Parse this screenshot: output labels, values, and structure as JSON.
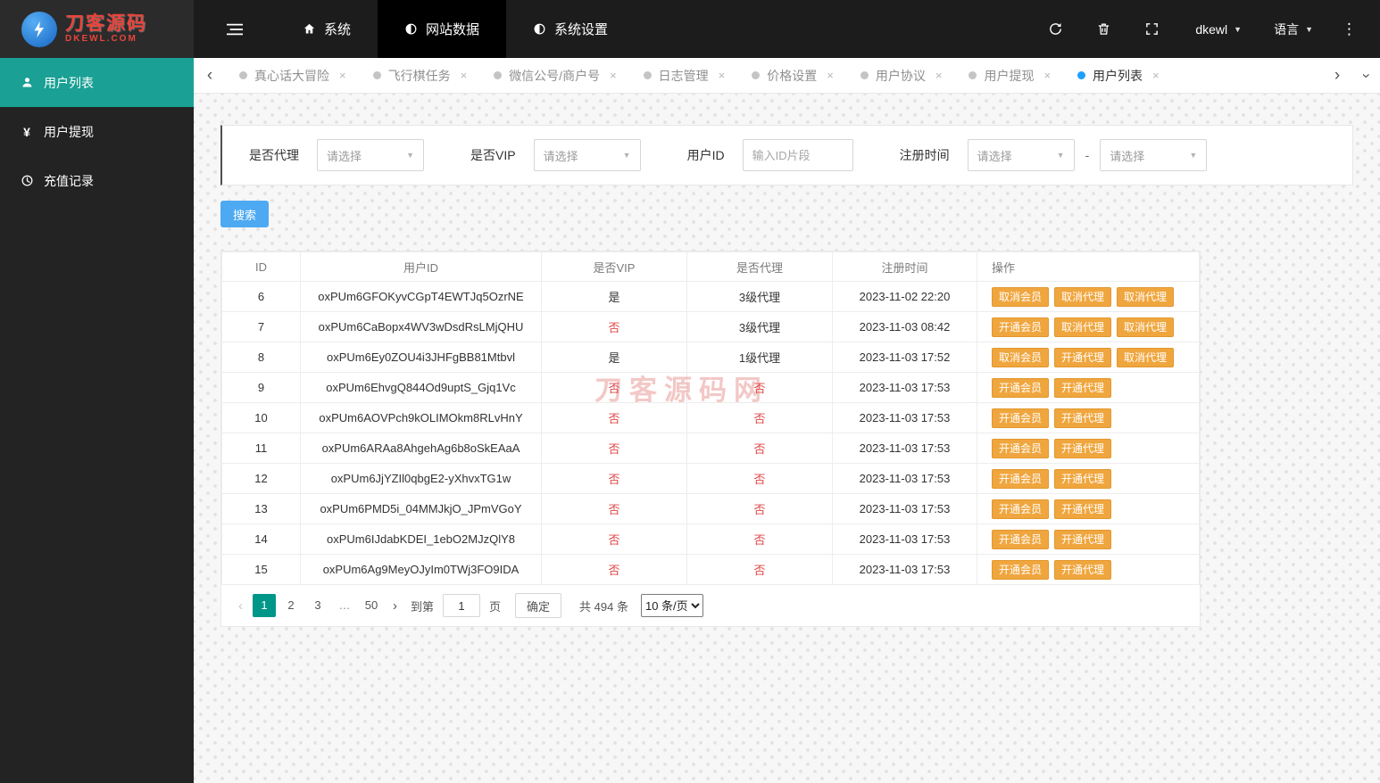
{
  "topbar": {
    "logo_title": "刀客源码",
    "logo_sub": "DKEWL.COM",
    "nav": [
      {
        "label": "系统",
        "icon": "home-icon",
        "active": false
      },
      {
        "label": "网站数据",
        "icon": "chart-pie-icon",
        "active": true
      },
      {
        "label": "系统设置",
        "icon": "settings-circle-icon",
        "active": false
      }
    ],
    "username": "dkewl",
    "language": "语言"
  },
  "sidebar": {
    "items": [
      {
        "label": "用户列表",
        "icon": "user-icon",
        "active": true
      },
      {
        "label": "用户提现",
        "icon": "yen-icon",
        "active": false
      },
      {
        "label": "充值记录",
        "icon": "clock-icon",
        "active": false
      }
    ]
  },
  "tabs": {
    "items": [
      {
        "label": "真心话大冒险",
        "active": false
      },
      {
        "label": "飞行棋任务",
        "active": false
      },
      {
        "label": "微信公号/商户号",
        "active": false
      },
      {
        "label": "日志管理",
        "active": false
      },
      {
        "label": "价格设置",
        "active": false
      },
      {
        "label": "用户协议",
        "active": false
      },
      {
        "label": "用户提现",
        "active": false
      },
      {
        "label": "用户列表",
        "active": true
      }
    ],
    "close_glyph": "×"
  },
  "filters": {
    "agent_label": "是否代理",
    "agent_value": "请选择",
    "vip_label": "是否VIP",
    "vip_value": "请选择",
    "userid_label": "用户ID",
    "userid_placeholder": "输入ID片段",
    "time_label": "注册时间",
    "time_from": "请选择",
    "time_to": "请选择",
    "separator": "-"
  },
  "search_label": "搜索",
  "watermark": "刀客源码网",
  "table": {
    "headers": [
      "ID",
      "用户ID",
      "是否VIP",
      "是否代理",
      "注册时间",
      "操作"
    ],
    "rows": [
      {
        "id": "6",
        "user_id": "oxPUm6GFOKyvCGpT4EWTJq5OzrNE",
        "vip": "是",
        "agent": "3级代理",
        "time": "2023-11-02 22:20",
        "actions": [
          "取消会员",
          "取消代理",
          "取消代理"
        ]
      },
      {
        "id": "7",
        "user_id": "oxPUm6CaBopx4WV3wDsdRsLMjQHU",
        "vip": "否",
        "agent": "3级代理",
        "time": "2023-11-03 08:42",
        "actions": [
          "开通会员",
          "取消代理",
          "取消代理"
        ]
      },
      {
        "id": "8",
        "user_id": "oxPUm6Ey0ZOU4i3JHFgBB81Mtbvl",
        "vip": "是",
        "agent": "1级代理",
        "time": "2023-11-03 17:52",
        "actions": [
          "取消会员",
          "开通代理",
          "取消代理"
        ]
      },
      {
        "id": "9",
        "user_id": "oxPUm6EhvgQ844Od9uptS_Gjq1Vc",
        "vip": "否",
        "agent": "否",
        "time": "2023-11-03 17:53",
        "actions": [
          "开通会员",
          "开通代理"
        ]
      },
      {
        "id": "10",
        "user_id": "oxPUm6AOVPch9kOLIMOkm8RLvHnY",
        "vip": "否",
        "agent": "否",
        "time": "2023-11-03 17:53",
        "actions": [
          "开通会员",
          "开通代理"
        ]
      },
      {
        "id": "11",
        "user_id": "oxPUm6ARAa8AhgehAg6b8oSkEAaA",
        "vip": "否",
        "agent": "否",
        "time": "2023-11-03 17:53",
        "actions": [
          "开通会员",
          "开通代理"
        ]
      },
      {
        "id": "12",
        "user_id": "oxPUm6JjYZIl0qbgE2-yXhvxTG1w",
        "vip": "否",
        "agent": "否",
        "time": "2023-11-03 17:53",
        "actions": [
          "开通会员",
          "开通代理"
        ]
      },
      {
        "id": "13",
        "user_id": "oxPUm6PMD5i_04MMJkjO_JPmVGoY",
        "vip": "否",
        "agent": "否",
        "time": "2023-11-03 17:53",
        "actions": [
          "开通会员",
          "开通代理"
        ]
      },
      {
        "id": "14",
        "user_id": "oxPUm6IJdabKDEI_1ebO2MJzQlY8",
        "vip": "否",
        "agent": "否",
        "time": "2023-11-03 17:53",
        "actions": [
          "开通会员",
          "开通代理"
        ]
      },
      {
        "id": "15",
        "user_id": "oxPUm6Ag9MeyOJyIm0TWj3FO9IDA",
        "vip": "否",
        "agent": "否",
        "time": "2023-11-03 17:53",
        "actions": [
          "开通会员",
          "开通代理"
        ]
      }
    ]
  },
  "pagination": {
    "pages": [
      {
        "label": "1",
        "active": true
      },
      {
        "label": "2",
        "active": false
      },
      {
        "label": "3",
        "active": false
      },
      {
        "label": "…",
        "ellipsis": true
      },
      {
        "label": "50",
        "active": false
      }
    ],
    "jump_prefix": "到第",
    "jump_value": "1",
    "jump_suffix": "页",
    "confirm_label": "确定",
    "total_label": "共 494 条",
    "per_page": "10 条/页"
  },
  "colors": {
    "accent_teal": "#1aa094",
    "accent_blue": "#4da9f2",
    "action_orange": "#f0a63e",
    "negative_red": "#e04848",
    "pagination_active": "#009688"
  }
}
